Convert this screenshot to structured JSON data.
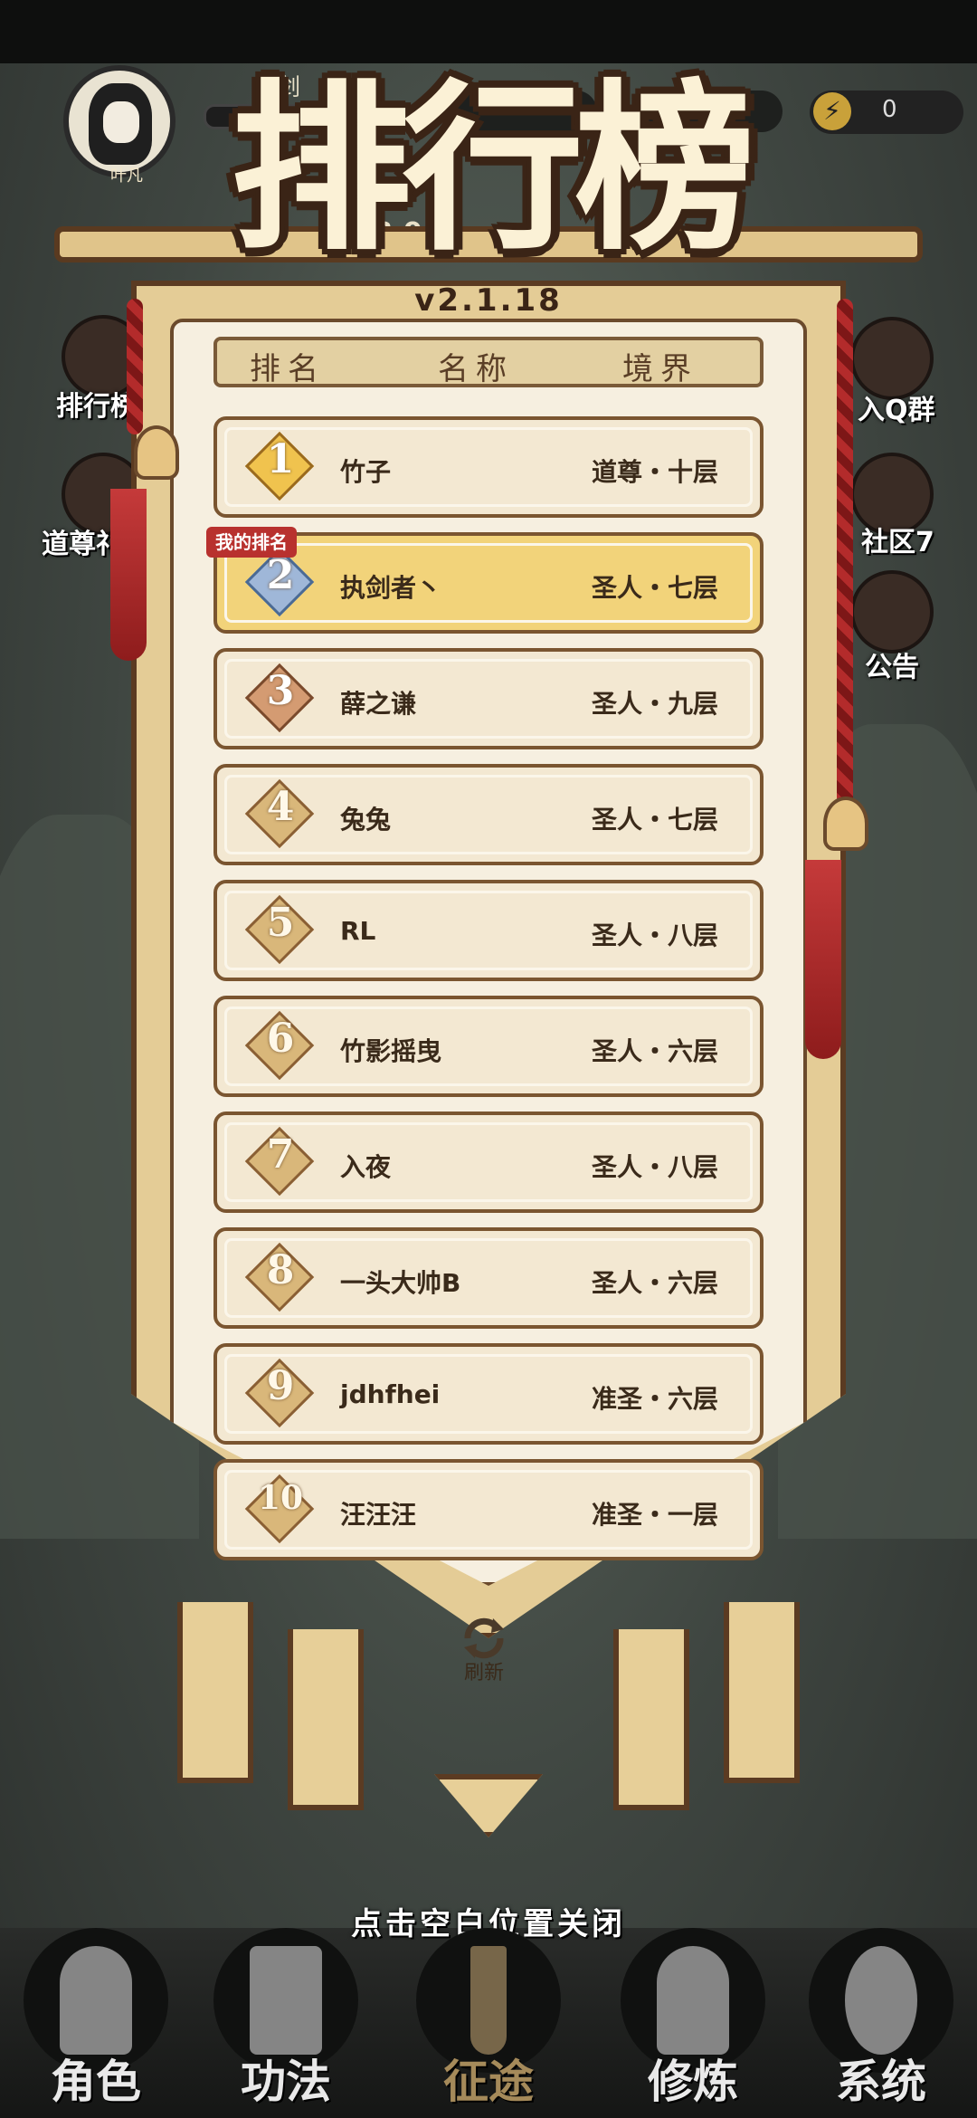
{
  "hud": {
    "avatar_name": "叶凡",
    "player_name_partial": "执剑",
    "stage": "18-9",
    "energy": "0"
  },
  "side_left": [
    "排行榜",
    "道尊礼"
  ],
  "side_right": [
    "入Q群",
    "社区7",
    "公告"
  ],
  "leaderboard": {
    "title": "排行榜",
    "version": "v2.1.18",
    "columns": [
      "排名",
      "名称",
      "境界"
    ],
    "my_rank_tag": "我的排名",
    "rows": [
      {
        "rank": "1",
        "name": "竹子",
        "realm": "道尊・十层"
      },
      {
        "rank": "2",
        "name": "执剑者丶",
        "realm": "圣人・七层"
      },
      {
        "rank": "3",
        "name": "薛之谦",
        "realm": "圣人・九层"
      },
      {
        "rank": "4",
        "name": "兔兔",
        "realm": "圣人・七层"
      },
      {
        "rank": "5",
        "name": "RL",
        "realm": "圣人・八层"
      },
      {
        "rank": "6",
        "name": "竹影摇曳",
        "realm": "圣人・六层"
      },
      {
        "rank": "7",
        "name": "入夜",
        "realm": "圣人・八层"
      },
      {
        "rank": "8",
        "name": "一头大帅B",
        "realm": "圣人・六层"
      },
      {
        "rank": "9",
        "name": "jdhfhei",
        "realm": "准圣・六层"
      },
      {
        "rank": "10",
        "name": "汪汪汪",
        "realm": "准圣・一层"
      }
    ],
    "refresh_label": "刷新"
  },
  "close_hint": "点击空白位置关闭",
  "nav": [
    "角色",
    "功法",
    "征途",
    "修炼",
    "系统"
  ],
  "colors": {
    "banner": "#e4cc96",
    "border": "#5b3b22",
    "mine_row": "#f2d37a",
    "tag": "#b8312e"
  }
}
